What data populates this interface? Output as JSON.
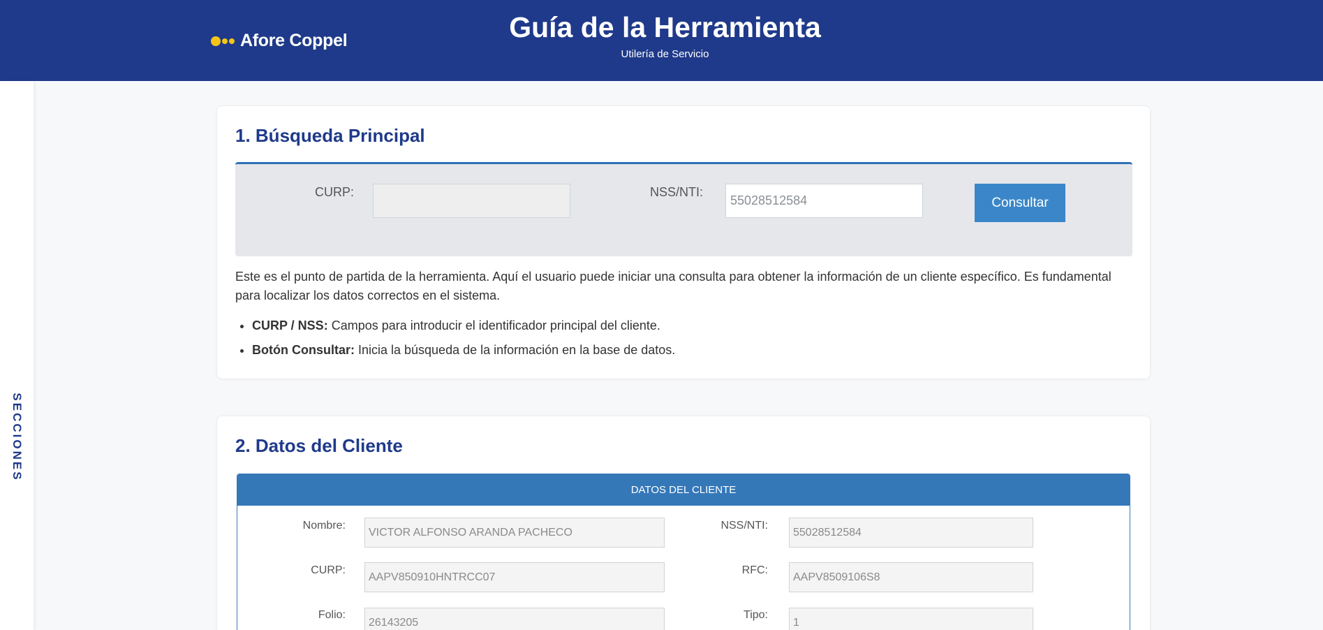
{
  "header": {
    "logo_text": "Afore Coppel",
    "title": "Guía de la Herramienta",
    "subtitle": "Utilería de Servicio",
    "background_color": "#1f3a8a",
    "logo_accent_color": "#f5c518"
  },
  "sidebar": {
    "label": "SECCIONES"
  },
  "section1": {
    "title": "1. Búsqueda Principal",
    "curp_label": "CURP:",
    "curp_value": "",
    "nss_label": "NSS/NTI:",
    "nss_value": "55028512584",
    "consultar_label": "Consultar",
    "description": "Este es el punto de partida de la herramienta. Aquí el usuario puede iniciar una consulta para obtener la información de un cliente específico. Es fundamental para localizar los datos correctos en el sistema.",
    "bullets": [
      {
        "term": "CURP / NSS:",
        "text": " Campos para introducir el identificador principal del cliente."
      },
      {
        "term": "Botón Consultar:",
        "text": " Inicia la búsqueda de la información en la base de datos."
      }
    ]
  },
  "section2": {
    "title": "2. Datos del Cliente",
    "panel_header": "DATOS DEL CLIENTE",
    "fields": {
      "nombre": {
        "label": "Nombre:",
        "value": "VICTOR ALFONSO ARANDA PACHECO"
      },
      "nss": {
        "label": "NSS/NTI:",
        "value": "55028512584"
      },
      "curp": {
        "label": "CURP:",
        "value": "AAPV850910HNTRCC07"
      },
      "rfc": {
        "label": "RFC:",
        "value": "AAPV8509106S8"
      },
      "folio": {
        "label": "Folio:",
        "value": "26143205"
      },
      "tipo": {
        "label": "Tipo:",
        "value": "1"
      }
    }
  },
  "colors": {
    "accent_blue": "#3a86c8",
    "panel_header_blue": "#3578b8",
    "title_blue": "#1f3a8a"
  }
}
